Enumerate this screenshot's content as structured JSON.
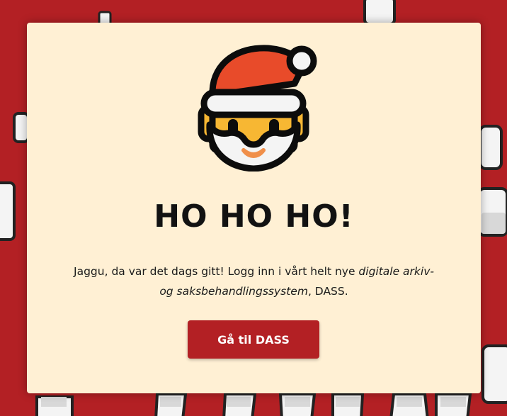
{
  "dialog": {
    "title": "HO HO HO!",
    "message_part1": "Jaggu, da var det dags gitt! Logg inn i vårt helt nye ",
    "message_emphasis": "digitale arkiv- og saksbehandlingssystem",
    "message_part2": ", DASS.",
    "button_label": "Gå til DASS"
  },
  "icons": {
    "hero": "santa-claus-emoji",
    "background_pattern": "toilet-icon"
  },
  "colors": {
    "page_background": "#b32024",
    "card_background": "#fff0d4",
    "button": "#b32024",
    "title_text": "#121212"
  }
}
